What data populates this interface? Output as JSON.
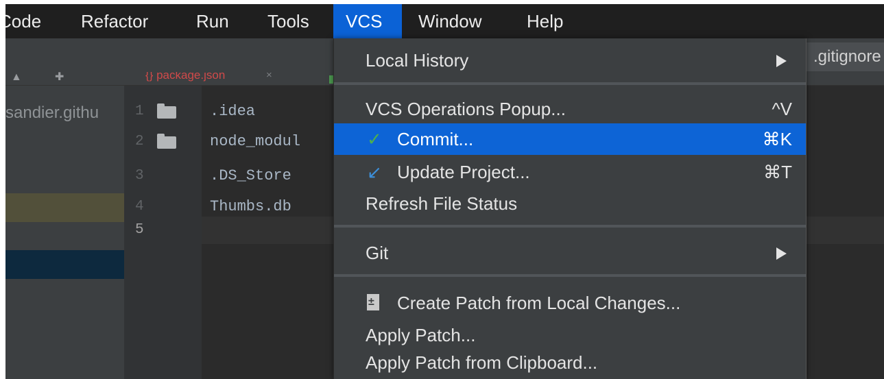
{
  "menubar": {
    "items": [
      {
        "label": "Code"
      },
      {
        "label": "Refactor"
      },
      {
        "label": "Run"
      },
      {
        "label": "Tools"
      },
      {
        "label": "VCS",
        "active": true
      },
      {
        "label": "Window"
      },
      {
        "label": "Help"
      }
    ]
  },
  "ide": {
    "tab": {
      "label": "package.json",
      "close": "×"
    },
    "gitignore_tab": ".gitignore",
    "project_item": "sandier.githu",
    "gutter_lines": [
      "1",
      "2",
      "3",
      "4",
      "5"
    ],
    "code_lines": [
      ".idea",
      "node_modul",
      ".DS_Store",
      "Thumbs.db",
      ""
    ]
  },
  "vcs_menu": {
    "local_history": "Local History",
    "vcs_operations_popup": {
      "label": "VCS Operations Popup...",
      "shortcut": "^V"
    },
    "commit": {
      "label": "Commit...",
      "shortcut": "⌘K"
    },
    "update_project": {
      "label": "Update Project...",
      "shortcut": "⌘T"
    },
    "refresh_file_status": "Refresh File Status",
    "git": "Git",
    "create_patch": "Create Patch from Local Changes...",
    "apply_patch": "Apply Patch...",
    "apply_patch_clipboard": "Apply Patch from Clipboard..."
  },
  "colors": {
    "menubar_bg": "#1f1f1f",
    "accent": "#0d64d6",
    "menu_bg": "#3c3f41",
    "commit_check": "#4caf50",
    "update_arrow": "#3d8fd8"
  }
}
